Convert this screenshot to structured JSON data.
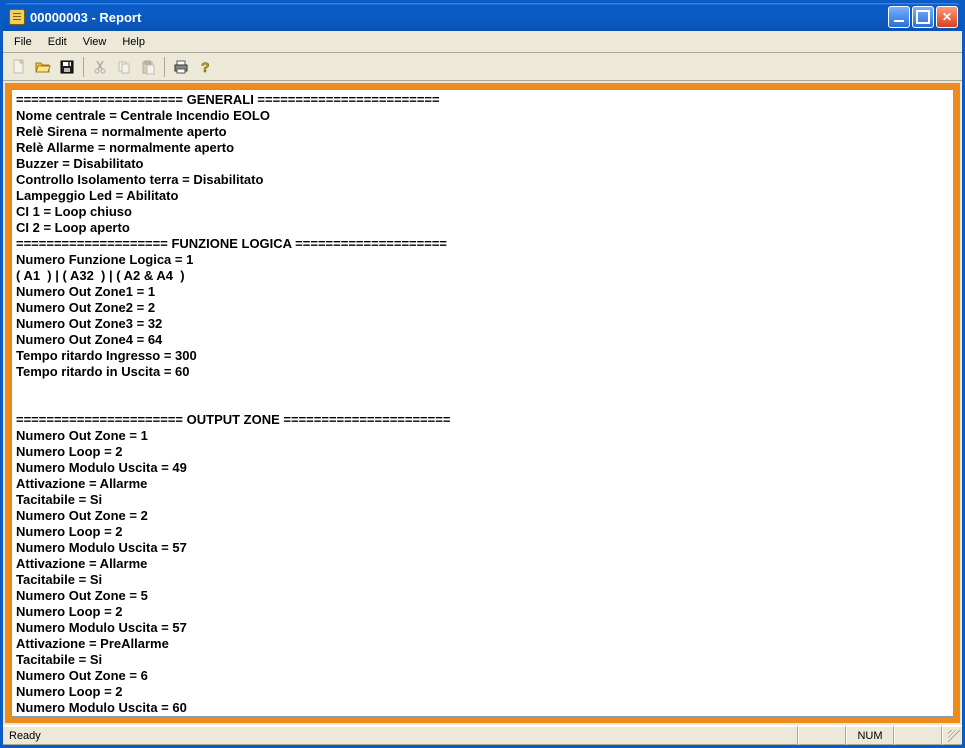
{
  "window": {
    "title": "00000003 - Report"
  },
  "menu": {
    "file": "File",
    "edit": "Edit",
    "view": "View",
    "help": "Help"
  },
  "status": {
    "ready": "Ready",
    "num": "NUM"
  },
  "report_text": "====================== GENERALI ========================\nNome centrale = Centrale Incendio EOLO\nRelè Sirena = normalmente aperto\nRelè Allarme = normalmente aperto\nBuzzer = Disabilitato\nControllo Isolamento terra = Disabilitato\nLampeggio Led = Abilitato\nCI 1 = Loop chiuso\nCI 2 = Loop aperto\n==================== FUNZIONE LOGICA ====================\nNumero Funzione Logica = 1\n( A1  ) | ( A32  ) | ( A2 & A4  )\nNumero Out Zone1 = 1\nNumero Out Zone2 = 2\nNumero Out Zone3 = 32\nNumero Out Zone4 = 64\nTempo ritardo Ingresso = 300\nTempo ritardo in Uscita = 60\n\n\n====================== OUTPUT ZONE ======================\nNumero Out Zone = 1\nNumero Loop = 2\nNumero Modulo Uscita = 49\nAttivazione = Allarme\nTacitabile = Si\nNumero Out Zone = 2\nNumero Loop = 2\nNumero Modulo Uscita = 57\nAttivazione = Allarme\nTacitabile = Si\nNumero Out Zone = 5\nNumero Loop = 2\nNumero Modulo Uscita = 57\nAttivazione = PreAllarme\nTacitabile = Si\nNumero Out Zone = 6\nNumero Loop = 2\nNumero Modulo Uscita = 60"
}
